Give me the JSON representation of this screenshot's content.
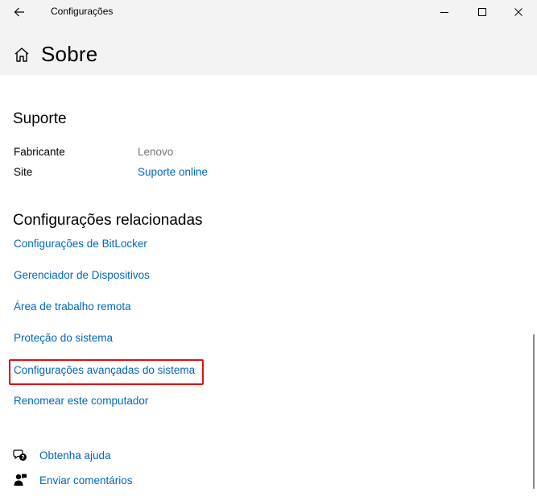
{
  "titlebar": {
    "app_title": "Configurações"
  },
  "header": {
    "title": "Sobre"
  },
  "support": {
    "title": "Suporte",
    "rows": [
      {
        "label": "Fabricante",
        "value": "Lenovo"
      },
      {
        "label": "Site",
        "value": "Suporte online"
      }
    ]
  },
  "related": {
    "title": "Configurações relacionadas",
    "links": [
      "Configurações de BitLocker",
      "Gerenciador de Dispositivos",
      "Área de trabalho remota",
      "Proteção do sistema",
      "Configurações avançadas do sistema",
      "Renomear este computador"
    ]
  },
  "help": {
    "get_help": "Obtenha ajuda",
    "feedback": "Enviar comentários"
  },
  "colors": {
    "link": "#0067c0",
    "header_bg": "#f3f3f3",
    "highlight": "#e01010"
  }
}
